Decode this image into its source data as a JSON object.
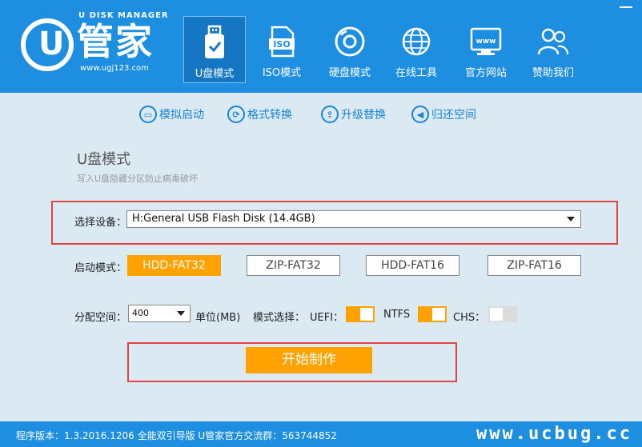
{
  "header": {
    "logo_top": "U DISK MANAGER",
    "logo_cn": "管家",
    "logo_url": "www.ugj123.com",
    "nav": [
      {
        "id": "usb",
        "label": "U盘模式",
        "icon": "usb-drive-icon"
      },
      {
        "id": "iso",
        "label": "ISO模式",
        "icon": "iso-file-icon"
      },
      {
        "id": "disk",
        "label": "硬盘模式",
        "icon": "disc-icon"
      },
      {
        "id": "online",
        "label": "在线工具",
        "icon": "globe-icon"
      },
      {
        "id": "site",
        "label": "官方网站",
        "icon": "website-icon"
      },
      {
        "id": "help",
        "label": "赞助我们",
        "icon": "people-icon"
      }
    ]
  },
  "toolbar": [
    {
      "label": "模拟启动",
      "icon": "monitor-icon"
    },
    {
      "label": "格式转换",
      "icon": "refresh-icon"
    },
    {
      "label": "升级替换",
      "icon": "upgrade-icon"
    },
    {
      "label": "归还空间",
      "icon": "return-icon"
    }
  ],
  "mode": {
    "title": "U盘模式",
    "subtitle": "写入U盘隐藏分区防止病毒破坏"
  },
  "device": {
    "label": "选择设备：",
    "value": "H:General USB Flash Disk (14.4GB)"
  },
  "boot": {
    "label": "启动模式：",
    "options": [
      "HDD-FAT32",
      "ZIP-FAT32",
      "HDD-FAT16",
      "ZIP-FAT16"
    ],
    "selected": "HDD-FAT32"
  },
  "partition": {
    "label": "分配空间：",
    "value": "400",
    "unit_label": "单位(MB)",
    "mode_label": "模式选择：",
    "uefi_label": "UEFI：",
    "ntfs_label": "NTFS",
    "chs_label": "CHS：",
    "uefi_on": true,
    "ntfs_on": true,
    "chs_on": false
  },
  "start_label": "开始制作",
  "footer": {
    "text": "程序版本：1.3.2016.1206 全能双引导版 U管家官方交流群：563744852",
    "watermark": "www.ucbug.cc"
  },
  "colors": {
    "header_blue": "#1e8fe0",
    "accent_orange": "#ffa200",
    "highlight_red": "#e64444"
  }
}
